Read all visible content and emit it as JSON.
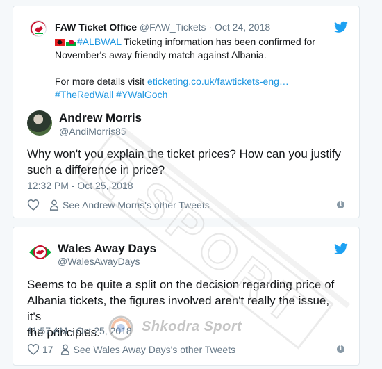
{
  "colors": {
    "link": "#1b95e0",
    "twitter_blue": "#1da1f2",
    "secondary_text": "#657786",
    "primary_text": "#14171a"
  },
  "card1": {
    "quoted": {
      "name": "FAW Ticket Office",
      "handle": "@FAW_Tickets",
      "date": "· Oct 24, 2018",
      "line1_hashtag": "#ALBWAL",
      "line1_text": " Ticketing information has been confirmed for",
      "line2": "November's away friendly match against Albania.",
      "line3_prefix": "For more details visit ",
      "line3_link": "eticketing.co.uk/fawtickets-eng…",
      "line4_hashtags": "#TheRedWall #YWalGoch",
      "icon": "twitter-bird-icon"
    },
    "reply": {
      "name": "Andrew Morris",
      "handle": "@AndiMorris85",
      "text_line1": "Why won't you explain the ticket prices? How can you justify",
      "text_line2": "such a difference in price?",
      "time": "12:32 PM - Oct 25, 2018",
      "other_tweets": "See Andrew Morris's other Tweets",
      "like_count": ""
    }
  },
  "card2": {
    "name": "Wales Away Days",
    "handle": "@WalesAwayDays",
    "text_line1": "Seems to be quite a split on the decision regarding price of",
    "text_line2": "Albania tickets, the figures involved aren't really the issue, it's",
    "text_line3": "the principles.",
    "time": "11:57 AM - Oct 25, 2018",
    "like_count": "17",
    "other_tweets": "See Wales Away Days's other Tweets",
    "icon": "twitter-bird-icon"
  },
  "watermarks": {
    "big": "SPORT",
    "big_prefix": "Q",
    "small": "Shkodra Sport"
  }
}
